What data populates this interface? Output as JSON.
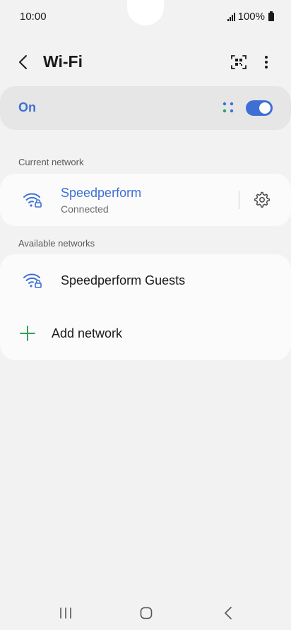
{
  "status_bar": {
    "time": "10:00",
    "battery": "100%"
  },
  "header": {
    "title": "Wi-Fi"
  },
  "master_switch": {
    "label": "On",
    "state": "on"
  },
  "current_network": {
    "section_label": "Current network",
    "name": "Speedperform",
    "status": "Connected"
  },
  "available_networks": {
    "section_label": "Available networks",
    "items": [
      {
        "name": "Speedperform Guests"
      }
    ],
    "add_label": "Add network"
  },
  "colors": {
    "accent": "#3e6fd4",
    "add_icon": "#2fa35a",
    "dots": [
      "#3e6fd4",
      "#2fa35a"
    ]
  },
  "icons": {
    "back": "back-arrow-icon",
    "qr": "qr-scan-icon",
    "more": "more-options-icon",
    "wifi": "wifi-lock-icon",
    "gear": "gear-icon",
    "plus": "plus-icon"
  }
}
